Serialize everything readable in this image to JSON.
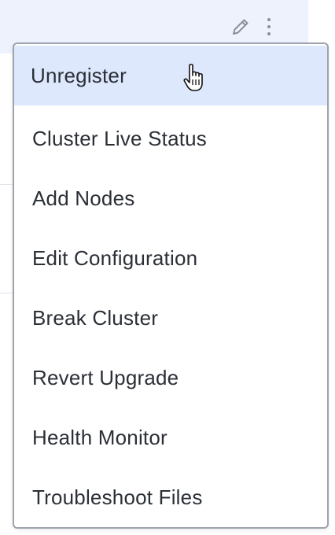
{
  "row_actions": {
    "edit_icon": "pencil-icon",
    "more_icon": "vertical-ellipsis-icon"
  },
  "menu": {
    "items": [
      {
        "label": "Unregister",
        "active": true
      },
      {
        "label": "Cluster Live Status"
      },
      {
        "label": "Add Nodes"
      },
      {
        "label": "Edit Configuration"
      },
      {
        "label": "Break Cluster"
      },
      {
        "label": "Revert Upgrade"
      },
      {
        "label": "Health Monitor"
      },
      {
        "label": "Troubleshoot Files"
      }
    ]
  },
  "colors": {
    "row_highlight": "#eef2fd",
    "active_item": "#dde8fd",
    "menu_border": "#9ea3ab",
    "text": "#2b2f36",
    "icon": "#8a8f98"
  },
  "cursor": "hand-pointer-icon"
}
